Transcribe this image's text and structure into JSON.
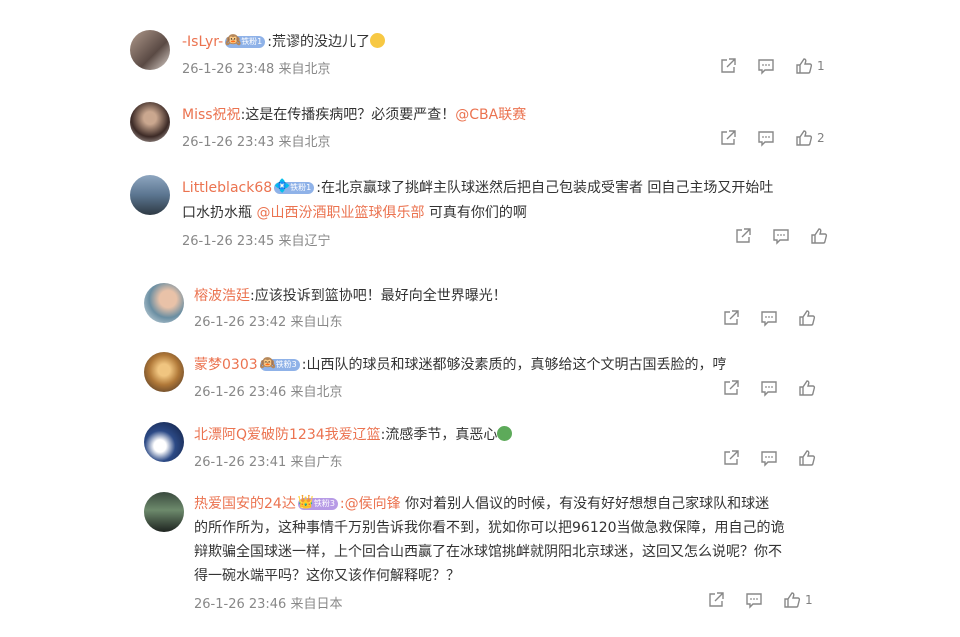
{
  "comments": [
    {
      "name": "-IsLyr-",
      "badge": "铁粉1",
      "text": ":荒谬的没边儿了",
      "emoji": "smile",
      "time": "26-1-26 23:48 来自北京",
      "like_count": "1"
    },
    {
      "name": "Miss祝祝",
      "text": ":这是在传播疾病吧？必须要严查！",
      "mention": "@CBA联赛",
      "time": "26-1-26 23:43 来自北京",
      "like_count": "2"
    },
    {
      "name": "Littleblack68",
      "badge": "铁粉1",
      "text_line1": ":在北京赢球了挑衅主队球迷然后把自己包装成受害者 回自己主场又开始吐",
      "text_line2": "口水扔水瓶 ",
      "mention": "@山西汾酒职业篮球俱乐部",
      "text_after": " 可真有你们的啊",
      "time": "26-1-26 23:45 来自辽宁",
      "like_count": ""
    },
    {
      "name": "榕波浩廷",
      "text": ":应该投诉到篮协吧！最好向全世界曝光！",
      "time": "26-1-26 23:42 来自山东",
      "like_count": ""
    },
    {
      "name": "蒙梦0303",
      "badge": "铁粉3",
      "text": ":山西队的球员和球迷都够没素质的，真够给这个文明古国丢脸的，哼",
      "time": "26-1-26 23:46 来自北京",
      "like_count": ""
    },
    {
      "name": "北漂阿Q爱破防1234我爱辽篮",
      "text": ":流感季节，真恶心",
      "emoji": "sick",
      "time": "26-1-26 23:41 来自广东",
      "like_count": ""
    },
    {
      "name": "热爱国安的24达",
      "badge": "铁粉3",
      "mention": ":@侯向锋",
      "text_line1": " 你对着别人倡议的时候，有没有好好想想自己家球队和球迷",
      "text_line2": "的所作所为，这种事情千万别告诉我你看不到，犹如你可以把96120当做急救保障，用自己的诡",
      "text_line3": "辩欺骗全国球迷一样，上个回合山西赢了在冰球馆挑衅就阴阳北京球迷，这回又怎么说呢？你不",
      "text_line4": "得一碗水端平吗？这你又该作何解释呢？？",
      "time": "26-1-26 23:46 来自日本",
      "like_count": "1"
    }
  ],
  "colors": {
    "name": "#eb7350",
    "meta": "#888888",
    "text": "#333333",
    "badge": "#8fb2e8"
  },
  "icons": [
    "share-icon",
    "comment-icon",
    "like-icon",
    "crown-icon",
    "fan-badge-icon"
  ]
}
